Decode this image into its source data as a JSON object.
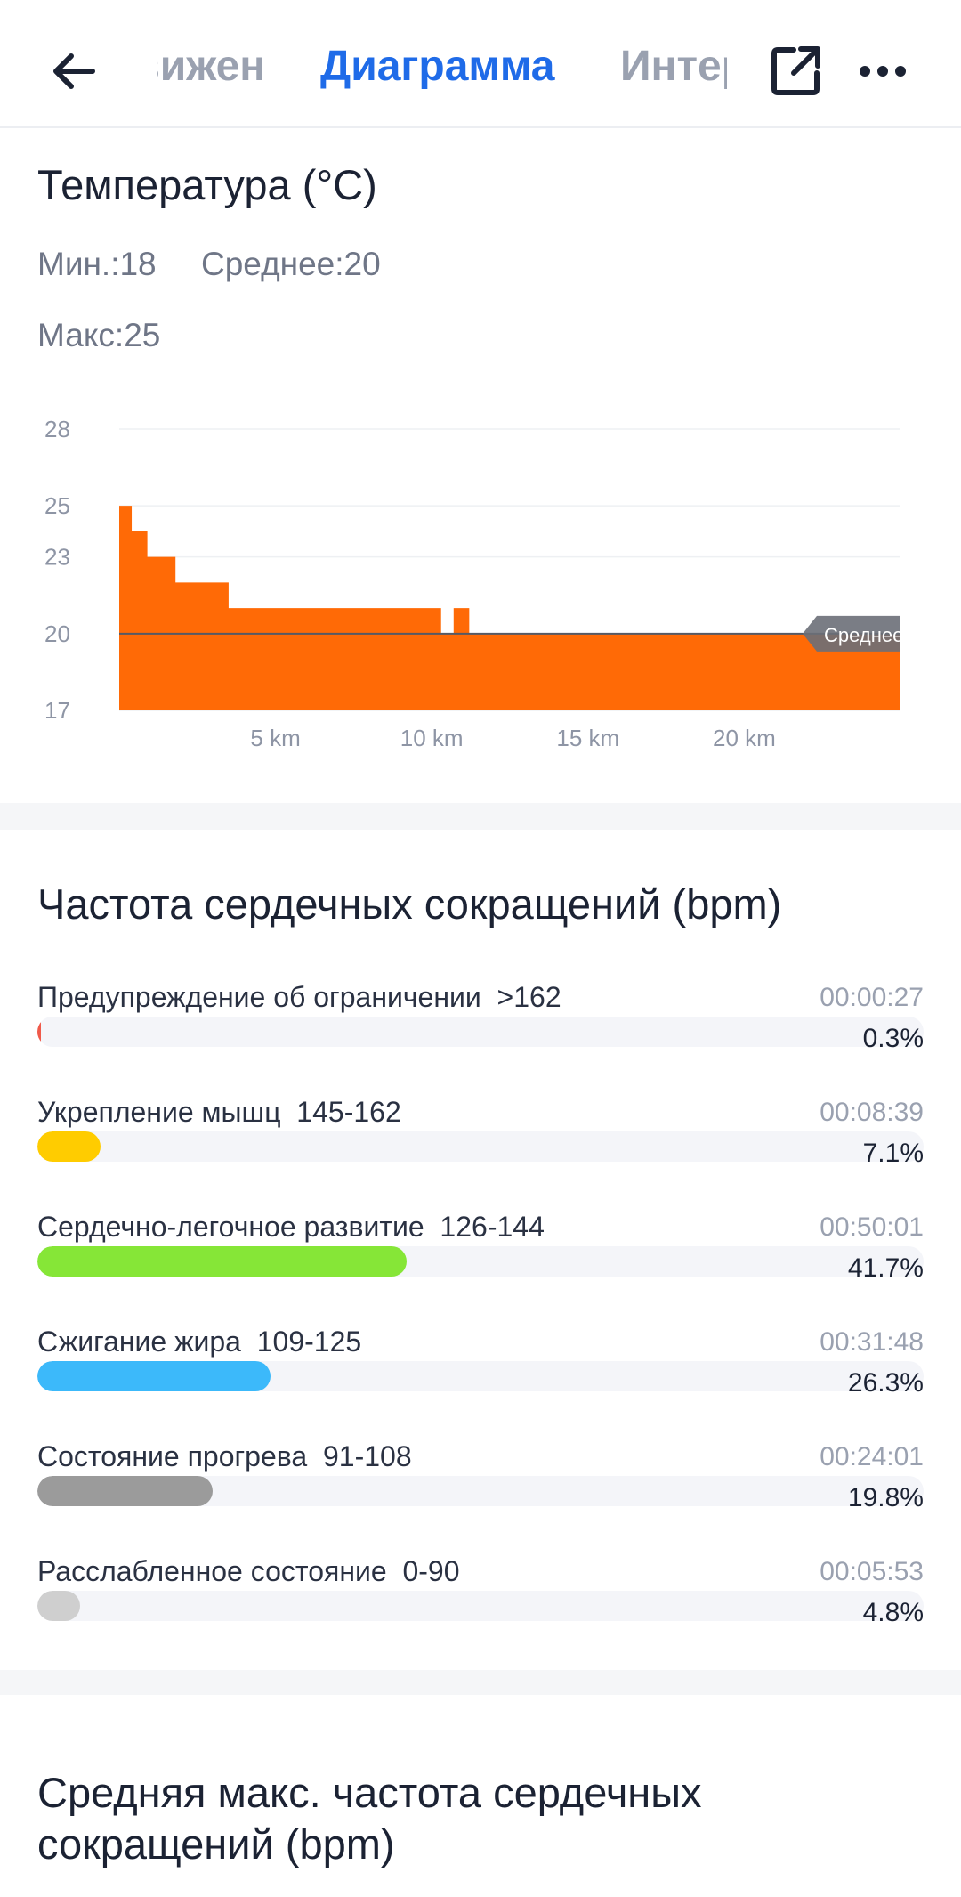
{
  "header": {
    "tab_prev": "Движение",
    "tab_active": "Диаграмма",
    "tab_next": "Интервалы",
    "icons": [
      "back-arrow-icon",
      "share-icon",
      "more-icon"
    ],
    "accent_color": "#1f6be8"
  },
  "temperature": {
    "title": "Температура (°C)",
    "min": "Мин.:18",
    "avg": "Среднее:20",
    "max": "Макс:25",
    "chart_data": {
      "type": "area",
      "title": "Температура (°C)",
      "xlabel": "",
      "ylabel": "",
      "x_unit": "km",
      "xlim": [
        0,
        25
      ],
      "ylim": [
        17,
        28
      ],
      "y_ticks": [
        17,
        20,
        23,
        25,
        28
      ],
      "x_ticks": [
        "5 km",
        "10 km",
        "15 km",
        "20 km"
      ],
      "x_tick_values": [
        5,
        10,
        15,
        20
      ],
      "average": 20,
      "average_label": "Среднее",
      "fill_color": "#ff6a06",
      "series": [
        {
          "x": [
            0,
            0.4,
            0.9,
            1.8,
            3.5,
            10.0,
            10.3,
            10.7,
            11.2,
            17.5,
            17.6,
            25.0
          ],
          "y": [
            25,
            24,
            23,
            22,
            21,
            21,
            20,
            21,
            20,
            20,
            20,
            19
          ]
        }
      ],
      "grid": true
    }
  },
  "heart_rate": {
    "title": "Частота сердечных сокращений (bpm)",
    "zones": [
      {
        "label": "Предупреждение об ограничении  >162",
        "time": "00:00:27",
        "percent_text": "0.3%",
        "percent": 0.3,
        "color": "#f05a4a"
      },
      {
        "label": "Укрепление мышц  145-162",
        "time": "00:08:39",
        "percent_text": "7.1%",
        "percent": 7.1,
        "color": "#ffcc00"
      },
      {
        "label": "Сердечно-легочное развитие  126-144",
        "time": "00:50:01",
        "percent_text": "41.7%",
        "percent": 41.7,
        "color": "#86e637"
      },
      {
        "label": "Сжигание жира  109-125",
        "time": "00:31:48",
        "percent_text": "26.3%",
        "percent": 26.3,
        "color": "#3cb9fa"
      },
      {
        "label": "Состояние прогрева  91-108",
        "time": "00:24:01",
        "percent_text": "19.8%",
        "percent": 19.8,
        "color": "#9b9b9b"
      },
      {
        "label": "Расслабленное состояние  0-90",
        "time": "00:05:53",
        "percent_text": "4.8%",
        "percent": 4.8,
        "color": "#cfcfcf"
      }
    ]
  },
  "avg_max_hr": {
    "title": "Средняя макс. частота сердечных сокращений (bpm)"
  }
}
